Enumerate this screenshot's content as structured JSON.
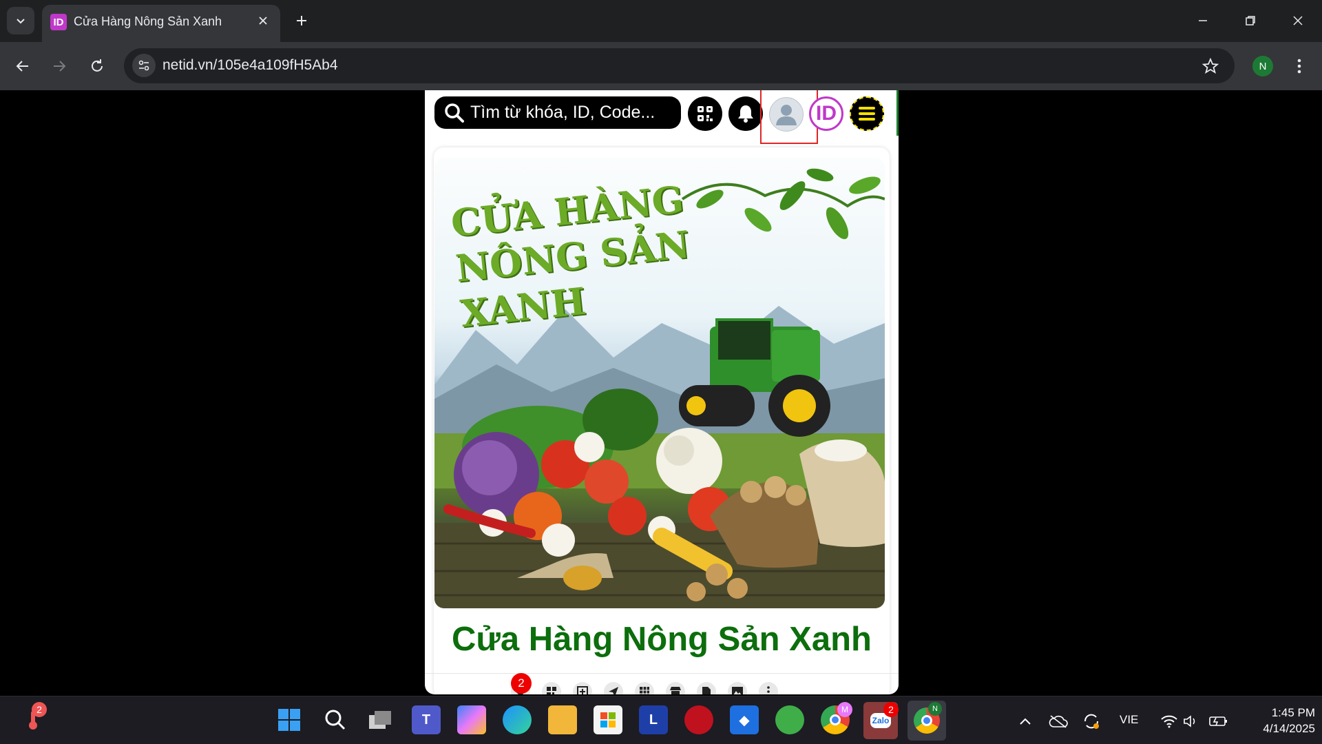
{
  "browser": {
    "tab_title": "Cửa Hàng Nông Sản Xanh",
    "tab_favicon_text": "ID",
    "url": "netid.vn/105e4a109fH5Ab4",
    "profile_initial": "N"
  },
  "page": {
    "search_placeholder": "Tìm từ khóa, ID, Code...",
    "banner_title_line1": "CỬA HÀNG",
    "banner_title_line2": "NÔNG SẢN XANH",
    "store_title": "Cửa Hàng Nông Sản Xanh",
    "like_count": "2",
    "logo_text": "ID",
    "icons": [
      "search-icon",
      "qr-code-icon",
      "bell-icon",
      "user-avatar-icon",
      "id-logo-icon",
      "hamburger-menu-icon"
    ],
    "action_icons": [
      "heart-icon",
      "qr-icon",
      "add-icon",
      "share-icon",
      "grid-icon",
      "store-icon",
      "document-icon",
      "gallery-icon",
      "more-icon"
    ]
  },
  "taskbar": {
    "weather_badge": "2",
    "zalo_label": "Zalo",
    "zalo_badge": "2",
    "chrome_profile_m": "M",
    "chrome_profile_n": "N",
    "l_app_label": "L",
    "language": "VIE",
    "time": "1:45 PM",
    "date": "4/14/2025"
  },
  "colors": {
    "accent_green": "#0c6e0c",
    "brand_purple": "#c038c9",
    "menu_yellow": "#f5e000",
    "highlight_red": "#e02424"
  }
}
